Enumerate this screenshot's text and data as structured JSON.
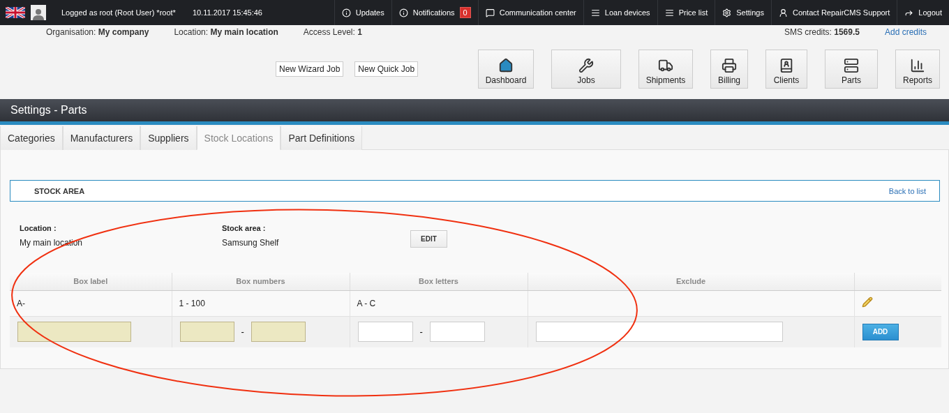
{
  "top_bar": {
    "user": "Logged as root (Root User) *root*",
    "datetime": "10.11.2017 15:45:46",
    "nav": [
      {
        "label": "Updates"
      },
      {
        "label": "Notifications",
        "badge": "0"
      },
      {
        "label": "Communication center"
      },
      {
        "label": "Loan devices"
      },
      {
        "label": "Price list"
      },
      {
        "label": "Settings"
      },
      {
        "label": "Contact RepairCMS Support"
      },
      {
        "label": "Logout"
      }
    ]
  },
  "info_bar": {
    "items": [
      {
        "label": "Organisation:",
        "value": "My company"
      },
      {
        "label": "Location:",
        "value": "My main location"
      },
      {
        "label": "Access Level:",
        "value": "1"
      }
    ],
    "sms_label": "SMS credits:",
    "sms_value": "1569.5",
    "add_credits": "Add credits"
  },
  "quick_buttons": [
    "New Wizard Job",
    "New Quick Job"
  ],
  "modules": [
    "Dashboard",
    "Jobs",
    "Shipments",
    "Billing",
    "Clients",
    "Parts",
    "Reports"
  ],
  "page_title": "Settings - Parts",
  "tabs": [
    {
      "label": "Categories",
      "selected": false
    },
    {
      "label": "Manufacturers",
      "selected": false
    },
    {
      "label": "Suppliers",
      "selected": false
    },
    {
      "label": "Stock Locations",
      "selected": true
    },
    {
      "label": "Part Definitions",
      "selected": false
    }
  ],
  "stock_area": {
    "title": "STOCK AREA",
    "back_link": "Back to list",
    "location_label": "Location :",
    "location_value": "My main location",
    "area_label": "Stock area :",
    "area_value": "Samsung Shelf",
    "edit_button": "EDIT"
  },
  "table": {
    "columns": [
      "Box label",
      "Box numbers",
      "Box letters",
      "Exclude"
    ],
    "rows": [
      {
        "box_label": "A-",
        "box_numbers": "1 - 100",
        "box_letters": "A - C",
        "editable": true
      }
    ],
    "input_row": {
      "cells": [
        {
          "fields": [
            {
              "required": true
            }
          ]
        },
        {
          "fields": [
            {
              "required": true
            },
            {
              "required": true
            }
          ],
          "separator": "-"
        },
        {
          "fields": [
            {
              "required": false
            },
            {
              "required": false
            }
          ],
          "separator": "-"
        },
        {
          "fields": [
            {
              "required": false
            }
          ]
        }
      ],
      "button": "ADD"
    }
  }
}
